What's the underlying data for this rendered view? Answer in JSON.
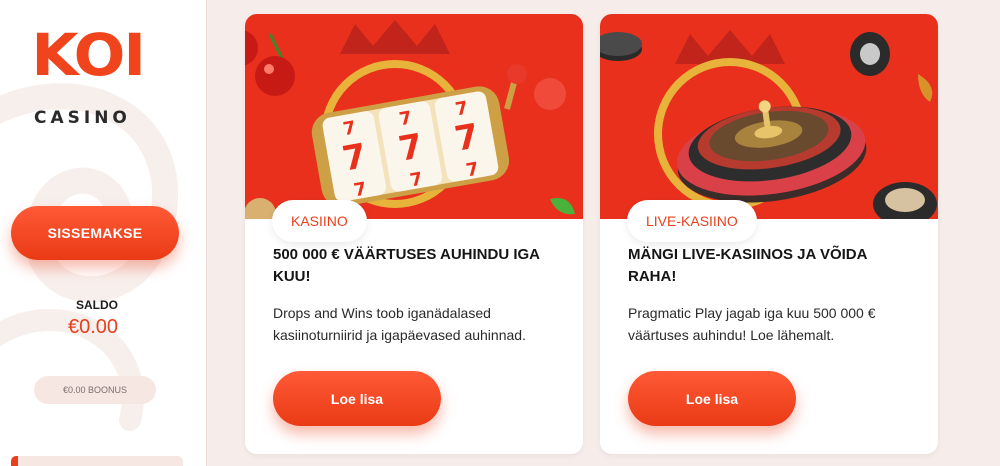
{
  "colors": {
    "accent": "#e8401c",
    "card_banner": "#e8301d",
    "page_bg": "#f6ece9"
  },
  "sidebar": {
    "logo": {
      "word": "KOI",
      "sub": "CASINO"
    },
    "deposit_label": "SISSEMAKSE",
    "saldo_label": "SALDO",
    "saldo_value": "€0.00",
    "bonus_label": "€0.00 BOONUS",
    "progress_fraction": 0.04
  },
  "cards": [
    {
      "image_icon": "slot-machine-icon",
      "tag": "KASIINO",
      "title": "500 000 € VÄÄRTUSES AUHINDU IGA KUU!",
      "description": "Drops and Wins toob iganädalased kasiinoturniirid ja igapäevased auhinnad.",
      "button_label": "Loe lisa"
    },
    {
      "image_icon": "roulette-wheel-icon",
      "tag": "LIVE-KASIINO",
      "title": "MÄNGI LIVE-KASIINOS JA VÕIDA RAHA!",
      "description": "Pragmatic Play jagab iga kuu 500 000 € väärtuses auhindu! Loe lähemalt.",
      "button_label": "Loe lisa"
    }
  ]
}
